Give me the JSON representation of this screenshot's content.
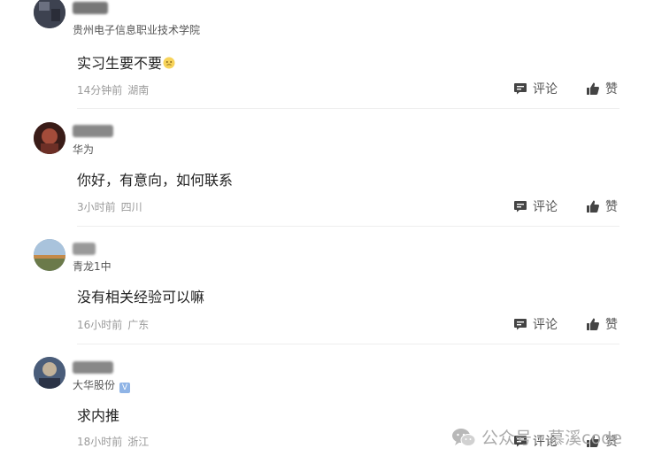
{
  "comments": [
    {
      "org": "贵州电子信息职业技术学院",
      "verified": false,
      "text": "实习生要不要",
      "emoji": "face-emoji",
      "time": "14分钟前",
      "location": "湖南",
      "reply_label": "评论",
      "like_label": "赞"
    },
    {
      "org": "华为",
      "verified": false,
      "text": "你好，有意向，如何联系",
      "time": "3小时前",
      "location": "四川",
      "reply_label": "评论",
      "like_label": "赞"
    },
    {
      "org": "青龙1中",
      "verified": false,
      "text": "没有相关经验可以嘛",
      "time": "16小时前",
      "location": "广东",
      "reply_label": "评论",
      "like_label": "赞"
    },
    {
      "org": "大华股份",
      "verified": true,
      "verified_mark": "V",
      "text": "求内推",
      "time": "18小时前",
      "location": "浙江",
      "reply_label": "评论",
      "like_label": "赞"
    }
  ],
  "watermark": {
    "text": "公众号 · 慕溪code",
    "icon": "wechat-icon"
  },
  "colors": {
    "text": "#222222",
    "meta": "#9a9a9a",
    "divider": "#eeeeee",
    "icon": "#444444",
    "verified_badge": "#8fb4e6"
  }
}
